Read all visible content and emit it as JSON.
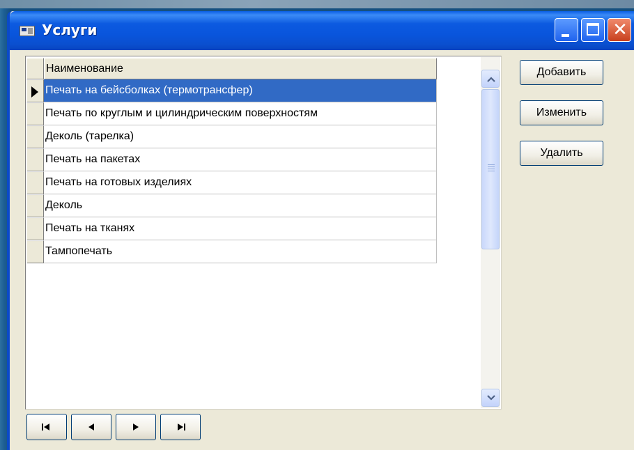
{
  "window": {
    "title": "Услуги"
  },
  "grid": {
    "column_header": "Наименование",
    "rows": [
      "Печать на бейсболках (термотрансфер)",
      "Печать по круглым и цилиндрическим поверхностям",
      "Деколь (тарелка)",
      "Печать на пакетах",
      "Печать на готовых изделиях",
      "Деколь",
      "Печать на тканях",
      "Тампопечать"
    ],
    "selected_index": 0
  },
  "buttons": {
    "add": "Добавить",
    "edit": "Изменить",
    "delete": "Удалить"
  },
  "nav_icons": [
    "first-record-icon",
    "previous-record-icon",
    "next-record-icon",
    "last-record-icon"
  ],
  "colors": {
    "selection": "#316ac5",
    "titlebar": "#0a4fcf"
  }
}
